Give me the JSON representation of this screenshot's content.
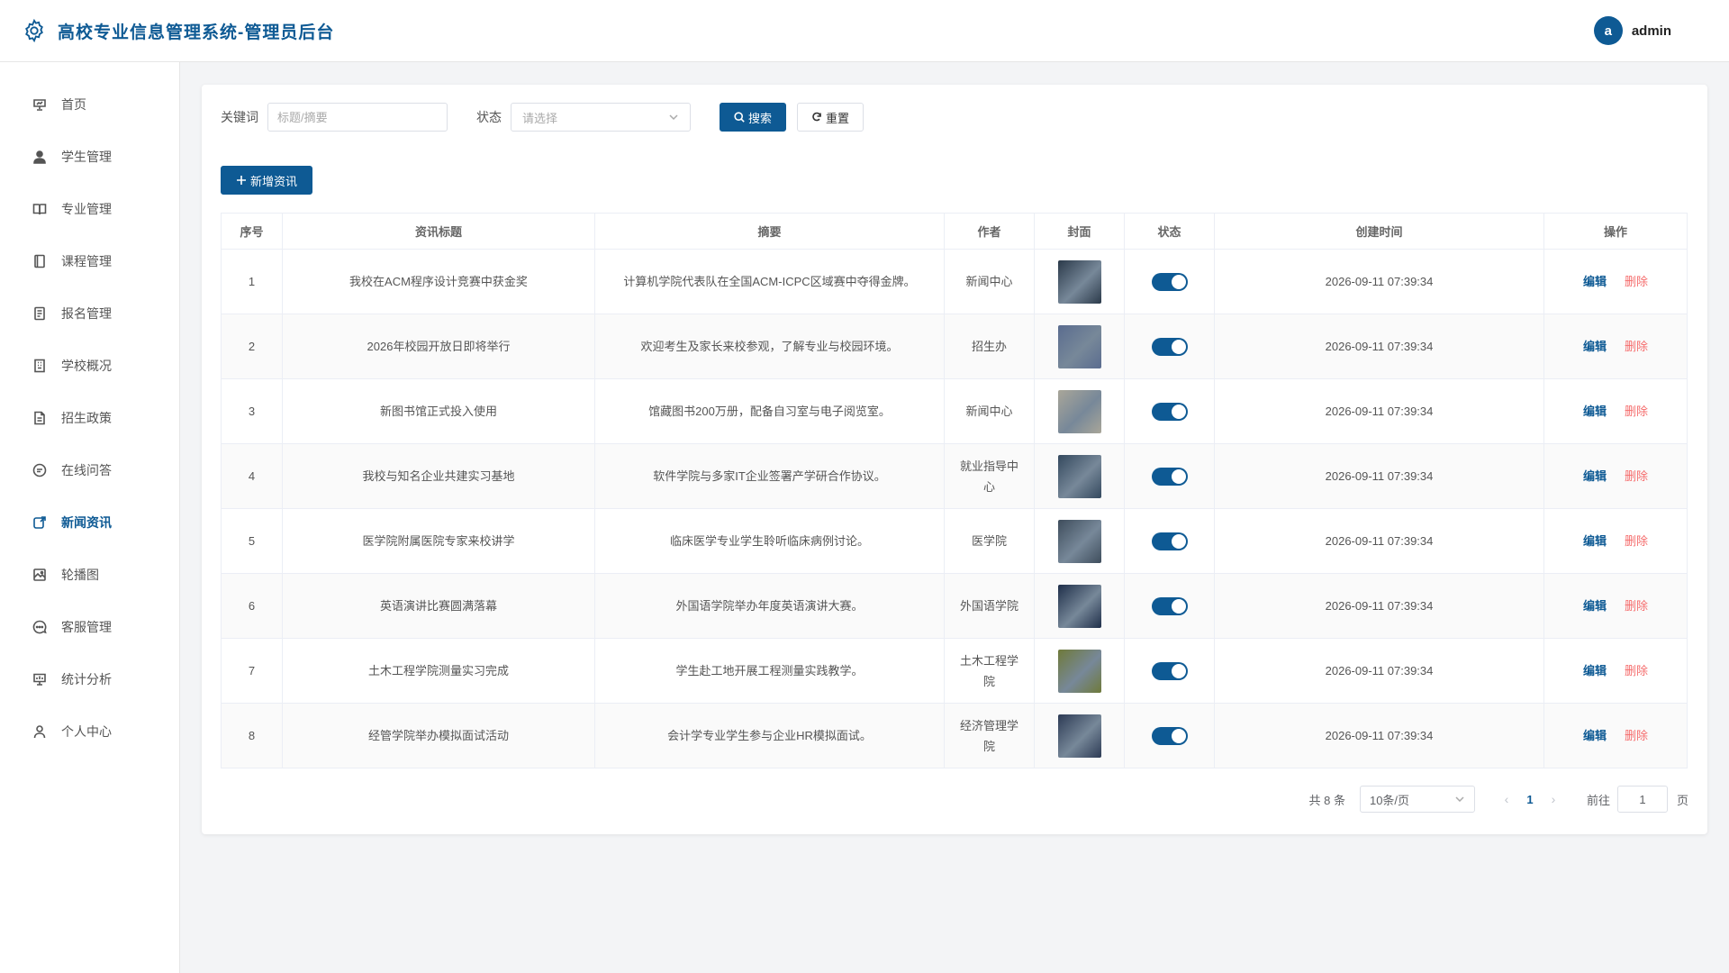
{
  "header": {
    "title": "高校专业信息管理系统-管理员后台",
    "avatar_letter": "a",
    "username": "admin"
  },
  "sidebar": {
    "items": [
      {
        "label": "首页",
        "icon": "presentation-icon",
        "active": false
      },
      {
        "label": "学生管理",
        "icon": "user-icon",
        "active": false
      },
      {
        "label": "专业管理",
        "icon": "book-icon",
        "active": false
      },
      {
        "label": "课程管理",
        "icon": "notebook-icon",
        "active": false
      },
      {
        "label": "报名管理",
        "icon": "document-icon",
        "active": false
      },
      {
        "label": "学校概况",
        "icon": "building-icon",
        "active": false
      },
      {
        "label": "招生政策",
        "icon": "file-text-icon",
        "active": false
      },
      {
        "label": "在线问答",
        "icon": "chat-icon",
        "active": false
      },
      {
        "label": "新闻资讯",
        "icon": "news-icon",
        "active": true
      },
      {
        "label": "轮播图",
        "icon": "picture-icon",
        "active": false
      },
      {
        "label": "客服管理",
        "icon": "service-icon",
        "active": false
      },
      {
        "label": "统计分析",
        "icon": "chart-icon",
        "active": false
      },
      {
        "label": "个人中心",
        "icon": "person-icon",
        "active": false
      }
    ]
  },
  "filters": {
    "keyword_label": "关键词",
    "keyword_placeholder": "标题/摘要",
    "keyword_value": "",
    "status_label": "状态",
    "status_placeholder": "请选择",
    "search_label": "搜索",
    "reset_label": "重置"
  },
  "add_label": "新增资讯",
  "table": {
    "columns": [
      "序号",
      "资讯标题",
      "摘要",
      "作者",
      "封面",
      "状态",
      "创建时间",
      "操作"
    ],
    "edit_label": "编辑",
    "delete_label": "删除",
    "rows": [
      {
        "index": "1",
        "title": "我校在ACM程序设计竞赛中获金奖",
        "summary": "计算机学院代表队在全国ACM-ICPC区域赛中夺得金牌。",
        "author": "新闻中心",
        "cover_color": "#2b3a4a",
        "status": true,
        "created": "2026-09-11 07:39:34"
      },
      {
        "index": "2",
        "title": "2026年校园开放日即将举行",
        "summary": "欢迎考生及家长来校参观，了解专业与校园环境。",
        "author": "招生办",
        "cover_color": "#5a6c8f",
        "status": true,
        "created": "2026-09-11 07:39:34"
      },
      {
        "index": "3",
        "title": "新图书馆正式投入使用",
        "summary": "馆藏图书200万册，配备自习室与电子阅览室。",
        "author": "新闻中心",
        "cover_color": "#a9a699",
        "status": true,
        "created": "2026-09-11 07:39:34"
      },
      {
        "index": "4",
        "title": "我校与知名企业共建实习基地",
        "summary": "软件学院与多家IT企业签署产学研合作协议。",
        "author": "就业指导中心",
        "cover_color": "#34495e",
        "status": true,
        "created": "2026-09-11 07:39:34"
      },
      {
        "index": "5",
        "title": "医学院附属医院专家来校讲学",
        "summary": "临床医学专业学生聆听临床病例讨论。",
        "author": "医学院",
        "cover_color": "#3e4d5c",
        "status": true,
        "created": "2026-09-11 07:39:34"
      },
      {
        "index": "6",
        "title": "英语演讲比赛圆满落幕",
        "summary": "外国语学院举办年度英语演讲大赛。",
        "author": "外国语学院",
        "cover_color": "#1f2f4a",
        "status": true,
        "created": "2026-09-11 07:39:34"
      },
      {
        "index": "7",
        "title": "土木工程学院测量实习完成",
        "summary": "学生赴工地开展工程测量实践教学。",
        "author": "土木工程学院",
        "cover_color": "#6f7a3a",
        "status": true,
        "created": "2026-09-11 07:39:34"
      },
      {
        "index": "8",
        "title": "经管学院举办模拟面试活动",
        "summary": "会计学专业学生参与企业HR模拟面试。",
        "author": "经济管理学院",
        "cover_color": "#2d3b55",
        "status": true,
        "created": "2026-09-11 07:39:34"
      }
    ]
  },
  "pagination": {
    "total_text": "共 8 条",
    "page_size": "10条/页",
    "current_page": "1",
    "goto_label": "前往",
    "goto_value": "1",
    "page_unit": "页"
  },
  "colors": {
    "primary": "#0e5a94",
    "danger": "#f56c6c"
  }
}
